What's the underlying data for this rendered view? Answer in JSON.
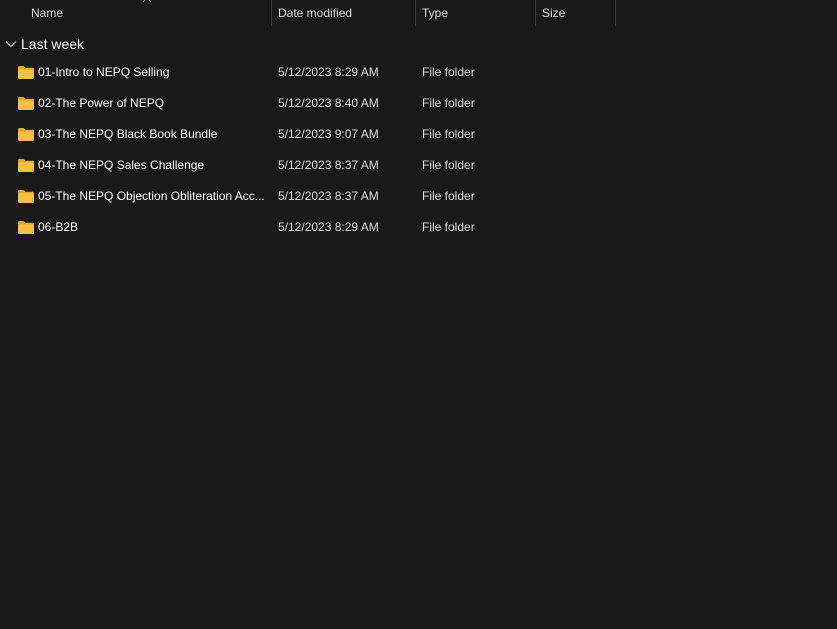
{
  "columns": {
    "name": "Name",
    "date_modified": "Date modified",
    "type": "Type",
    "size": "Size"
  },
  "sort": {
    "column": "name",
    "icon": "sort-ascending-caret"
  },
  "group": {
    "label": "Last week",
    "icon": "chevron-down-icon"
  },
  "folder_icon_color": "#f5c143",
  "items": [
    {
      "name": "01-Intro to NEPQ Selling",
      "date": "5/12/2023 8:29 AM",
      "type": "File folder",
      "size": ""
    },
    {
      "name": "02-The Power of NEPQ",
      "date": "5/12/2023 8:40 AM",
      "type": "File folder",
      "size": ""
    },
    {
      "name": "03-The NEPQ Black Book Bundle",
      "date": "5/12/2023 9:07 AM",
      "type": "File folder",
      "size": ""
    },
    {
      "name": "04-The NEPQ Sales Challenge",
      "date": "5/12/2023 8:37 AM",
      "type": "File folder",
      "size": ""
    },
    {
      "name": "05-The NEPQ Objection Obliteration Acc...",
      "date": "5/12/2023 8:37 AM",
      "type": "File folder",
      "size": ""
    },
    {
      "name": "06-B2B",
      "date": "5/12/2023 8:29 AM",
      "type": "File folder",
      "size": ""
    }
  ]
}
